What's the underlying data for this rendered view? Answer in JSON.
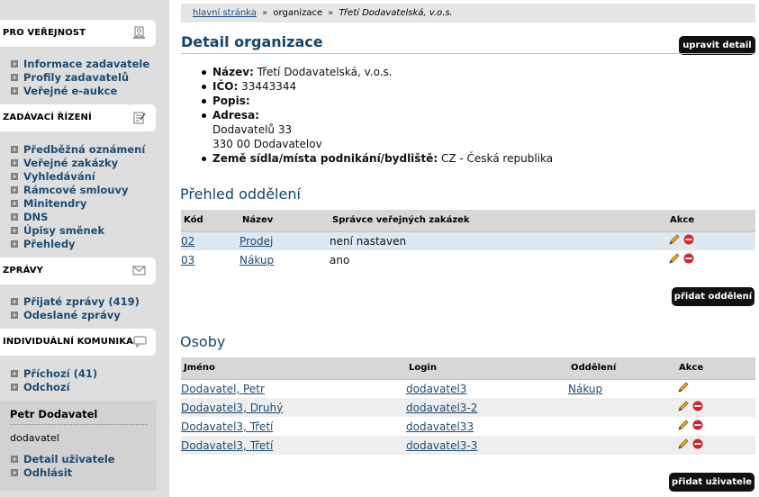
{
  "sidebar": {
    "sections": [
      {
        "label": "PRO VEŘEJNOST",
        "icon": "public-icon",
        "items": [
          "Informace zadavatele",
          "Profily zadavatelů",
          "Veřejné e-aukce"
        ]
      },
      {
        "label": "ZADÁVACÍ ŘÍZENÍ",
        "icon": "procurement-icon",
        "items": [
          "Předběžná oznámení",
          "Veřejné zakázky",
          "Vyhledávání",
          "Rámcové smlouvy",
          "Minitendry",
          "DNS",
          "Úpisy směnek",
          "Přehledy"
        ]
      },
      {
        "label": "ZPRÁVY",
        "icon": "envelope-icon",
        "items": [
          "Přijaté zprávy (419)",
          "Odeslané zprávy"
        ]
      },
      {
        "label": "INDIVIDUÁLNÍ KOMUNIKACE",
        "icon": "chat-icon",
        "items": [
          "Příchozí (41)",
          "Odchozí"
        ]
      }
    ],
    "user": {
      "name": "Petr Dodavatel",
      "login": "dodavatel",
      "links": [
        "Detail uživatele",
        "Odhlásit"
      ]
    }
  },
  "breadcrumb": {
    "home": "hlavní stránka",
    "sep": "»",
    "middle": "organizace",
    "current": "Třetí Dodavatelská, v.o.s."
  },
  "page": {
    "title": "Detail organizace",
    "edit_button": "upravit detail"
  },
  "details": {
    "name_label": "Název:",
    "name_value": "Třetí Dodavatelská, v.o.s.",
    "ico_label": "IČO:",
    "ico_value": "33443344",
    "desc_label": "Popis:",
    "address_label": "Adresa:",
    "address_line1": "Dodavatelů 33",
    "address_line2": "330 00 Dodavatelov",
    "country_label": "Země sídla/místa podnikání/bydliště:",
    "country_value": "CZ - Česká republika"
  },
  "departments": {
    "title": "Přehled oddělení",
    "columns": [
      "Kód",
      "Název",
      "Správce veřejných zakázek",
      "Akce"
    ],
    "rows": [
      {
        "code": "02",
        "name": "Prodej",
        "manager": "není nastaven"
      },
      {
        "code": "03",
        "name": "Nákup",
        "manager": "ano"
      }
    ],
    "add_button": "přidat oddělení"
  },
  "people": {
    "title": "Osoby",
    "columns": [
      "Jméno",
      "Login",
      "Oddělení",
      "Akce"
    ],
    "rows": [
      {
        "name": "Dodavatel, Petr",
        "login": "dodavatel3",
        "dept": "Nákup",
        "deletable": false
      },
      {
        "name": "Dodavatel3, Druhý",
        "login": "dodavatel3-2",
        "dept": "",
        "deletable": true
      },
      {
        "name": "Dodavatel3, Třetí",
        "login": "dodavatel33",
        "dept": "",
        "deletable": true
      },
      {
        "name": "Dodavatel3, Třetí",
        "login": "dodavatel3-3",
        "dept": "",
        "deletable": true
      }
    ],
    "add_button": "přidat uživatele"
  },
  "colors": {
    "link": "#1d4c73",
    "title": "#12476d",
    "sidebar_bg": "#dedede",
    "highlight_row": "#dde8f1",
    "button_bg": "#111111"
  }
}
